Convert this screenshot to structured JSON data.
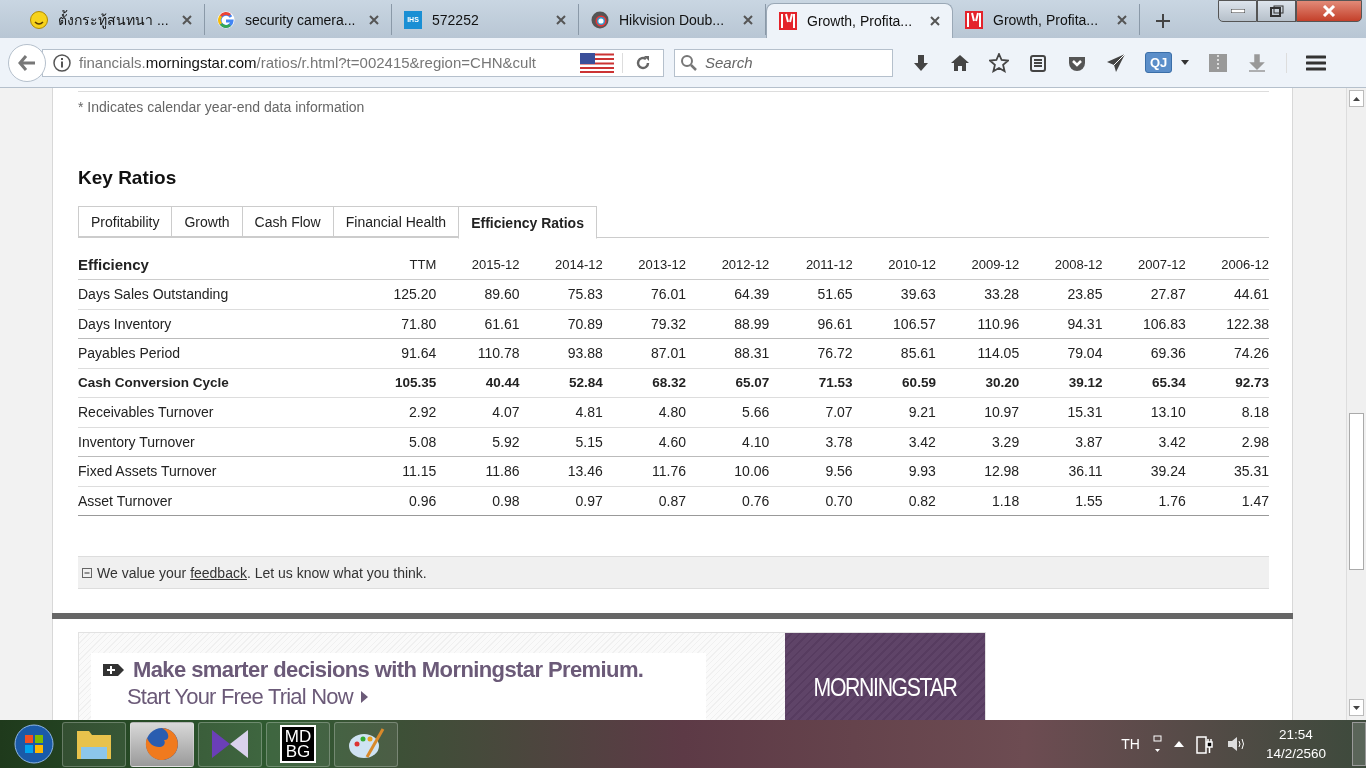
{
  "browser": {
    "tabs": [
      {
        "title": "ตั้งกระทู้สนทนา ...",
        "kind": "emoji",
        "selected": false
      },
      {
        "title": "security camera...",
        "kind": "g",
        "selected": false
      },
      {
        "title": "572252",
        "kind": "ihs",
        "icon_text": "IHS",
        "selected": false
      },
      {
        "title": "Hikvision Doub...",
        "kind": "ring",
        "selected": false
      },
      {
        "title": "Growth, Profita...",
        "kind": "m",
        "selected": true
      },
      {
        "title": "Growth, Profita...",
        "kind": "m",
        "selected": false
      }
    ],
    "url": {
      "prefix": "financials.",
      "host": "morningstar.com",
      "path": "/ratios/r.html?t=002415&region=CHN&cult"
    },
    "search": {
      "placeholder": "Search"
    },
    "extension_label": "QJ"
  },
  "page": {
    "note": "* Indicates calendar year-end data information",
    "heading": "Key Ratios",
    "tabs": [
      {
        "label": "Profitability",
        "selected": false
      },
      {
        "label": "Growth",
        "selected": false
      },
      {
        "label": "Cash Flow",
        "selected": false
      },
      {
        "label": "Financial Health",
        "selected": false
      },
      {
        "label": "Efficiency Ratios",
        "selected": true
      }
    ],
    "table": {
      "columns": [
        "Efficiency",
        "TTM",
        "2015-12",
        "2014-12",
        "2013-12",
        "2012-12",
        "2011-12",
        "2010-12",
        "2009-12",
        "2008-12",
        "2007-12",
        "2006-12"
      ],
      "rows": [
        {
          "label": "Days Sales Outstanding",
          "bold": false,
          "values": [
            "125.20",
            "89.60",
            "75.83",
            "76.01",
            "64.39",
            "51.65",
            "39.63",
            "33.28",
            "23.85",
            "27.87",
            "44.61"
          ]
        },
        {
          "label": "Days Inventory",
          "bold": false,
          "values": [
            "71.80",
            "61.61",
            "70.89",
            "79.32",
            "88.99",
            "96.61",
            "106.57",
            "110.96",
            "94.31",
            "106.83",
            "122.38"
          ]
        },
        {
          "label": "Payables Period",
          "bold": false,
          "values": [
            "91.64",
            "110.78",
            "93.88",
            "87.01",
            "88.31",
            "76.72",
            "85.61",
            "114.05",
            "79.04",
            "69.36",
            "74.26"
          ]
        },
        {
          "label": "Cash Conversion Cycle",
          "bold": true,
          "values": [
            "105.35",
            "40.44",
            "52.84",
            "68.32",
            "65.07",
            "71.53",
            "60.59",
            "30.20",
            "39.12",
            "65.34",
            "92.73"
          ]
        },
        {
          "label": "Receivables Turnover",
          "bold": false,
          "values": [
            "2.92",
            "4.07",
            "4.81",
            "4.80",
            "5.66",
            "7.07",
            "9.21",
            "10.97",
            "15.31",
            "13.10",
            "8.18"
          ]
        },
        {
          "label": "Inventory Turnover",
          "bold": false,
          "values": [
            "5.08",
            "5.92",
            "5.15",
            "4.60",
            "4.10",
            "3.78",
            "3.42",
            "3.29",
            "3.87",
            "3.42",
            "2.98"
          ]
        },
        {
          "label": "Fixed Assets Turnover",
          "bold": false,
          "values": [
            "11.15",
            "11.86",
            "13.46",
            "11.76",
            "10.06",
            "9.56",
            "9.93",
            "12.98",
            "36.11",
            "39.24",
            "35.31"
          ]
        },
        {
          "label": "Asset Turnover",
          "bold": false,
          "values": [
            "0.96",
            "0.98",
            "0.97",
            "0.87",
            "0.76",
            "0.70",
            "0.82",
            "1.18",
            "1.55",
            "1.76",
            "1.47"
          ]
        }
      ]
    },
    "feedback": {
      "before": "We value your ",
      "link": "feedback",
      "after": ". Let us know what you think."
    },
    "banner": {
      "headline": "Make smarter decisions with Morningstar Premium.",
      "cta": "Start Your Free Trial Now",
      "logo": "MORNINGSTAR"
    }
  },
  "taskbar": {
    "items": [
      {
        "kind": "folder",
        "selected": false
      },
      {
        "kind": "firefox",
        "selected": true
      },
      {
        "kind": "player",
        "selected": false
      },
      {
        "kind": "mdbg",
        "label_top": "MD",
        "label_bottom": "BG",
        "selected": false
      },
      {
        "kind": "paint",
        "selected": false
      }
    ],
    "language": "TH",
    "time": "21:54",
    "date": "14/2/2560"
  }
}
